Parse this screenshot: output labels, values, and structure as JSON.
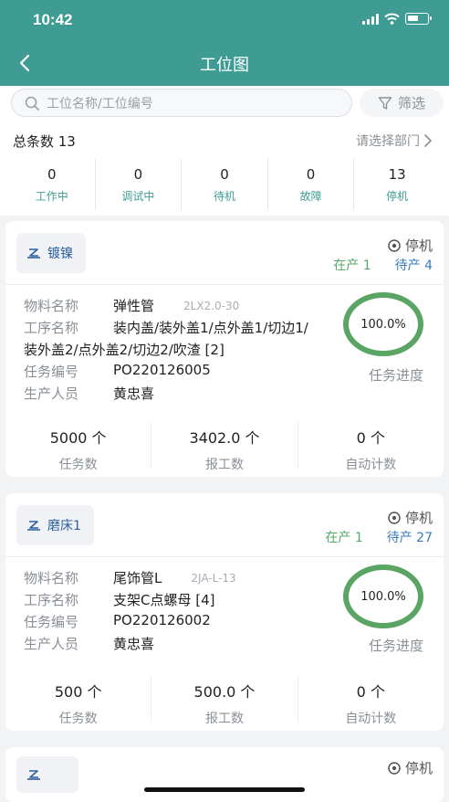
{
  "status_bar": {
    "time": "10:42"
  },
  "nav": {
    "title": "工位图"
  },
  "search": {
    "placeholder": "工位名称/工位编号",
    "filter_label": "筛选"
  },
  "summary": {
    "total_label": "总条数 13",
    "dept_label": "请选择部门",
    "stats": [
      {
        "value": "0",
        "label": "工作中"
      },
      {
        "value": "0",
        "label": "调试中"
      },
      {
        "value": "0",
        "label": "待机"
      },
      {
        "value": "0",
        "label": "故障"
      },
      {
        "value": "13",
        "label": "停机"
      }
    ]
  },
  "cards": [
    {
      "machine": "镀镍",
      "status": "停机",
      "in_production": "在产 1",
      "waiting": "待产 4",
      "fields": [
        {
          "key": "物料名称",
          "value": "弹性管",
          "sub": "2LX2.0-30"
        },
        {
          "key": "工序名称",
          "value": "装内盖/装外盖1/点外盖1/切边1/",
          "cont": "装外盖2/点外盖2/切边2/吹渣 [2]"
        },
        {
          "key": "任务编号",
          "value": "PO220126005"
        },
        {
          "key": "生产人员",
          "value": "黄忠喜"
        }
      ],
      "progress": "100.0%",
      "progress_fraction": 1.0,
      "progress_label": "任务进度",
      "footer": [
        {
          "value": "5000 个",
          "label": "任务数"
        },
        {
          "value": "3402.0 个",
          "label": "报工数"
        },
        {
          "value": "0 个",
          "label": "自动计数"
        }
      ]
    },
    {
      "machine": "磨床1",
      "status": "停机",
      "in_production": "在产 1",
      "waiting": "待产 27",
      "fields": [
        {
          "key": "物料名称",
          "value": "尾饰管L",
          "sub": "2JA-L-13"
        },
        {
          "key": "工序名称",
          "value": "支架C点螺母 [4]"
        },
        {
          "key": "任务编号",
          "value": "PO220126002"
        },
        {
          "key": "生产人员",
          "value": "黄忠喜"
        }
      ],
      "progress": "100.0%",
      "progress_fraction": 1.0,
      "progress_label": "任务进度",
      "footer": [
        {
          "value": "500 个",
          "label": "任务数"
        },
        {
          "value": "500.0 个",
          "label": "报工数"
        },
        {
          "value": "0 个",
          "label": "自动计数"
        }
      ]
    }
  ],
  "partial_card": {
    "status": "停机"
  },
  "colors": {
    "primary": "#3f9c95",
    "in_production": "#55a96a",
    "waiting": "#3c7dbc",
    "ring": "#5aa464"
  },
  "icons": [
    "back-arrow-icon",
    "search-icon",
    "filter-icon",
    "chevron-right-icon",
    "machine-icon",
    "eye-icon"
  ]
}
